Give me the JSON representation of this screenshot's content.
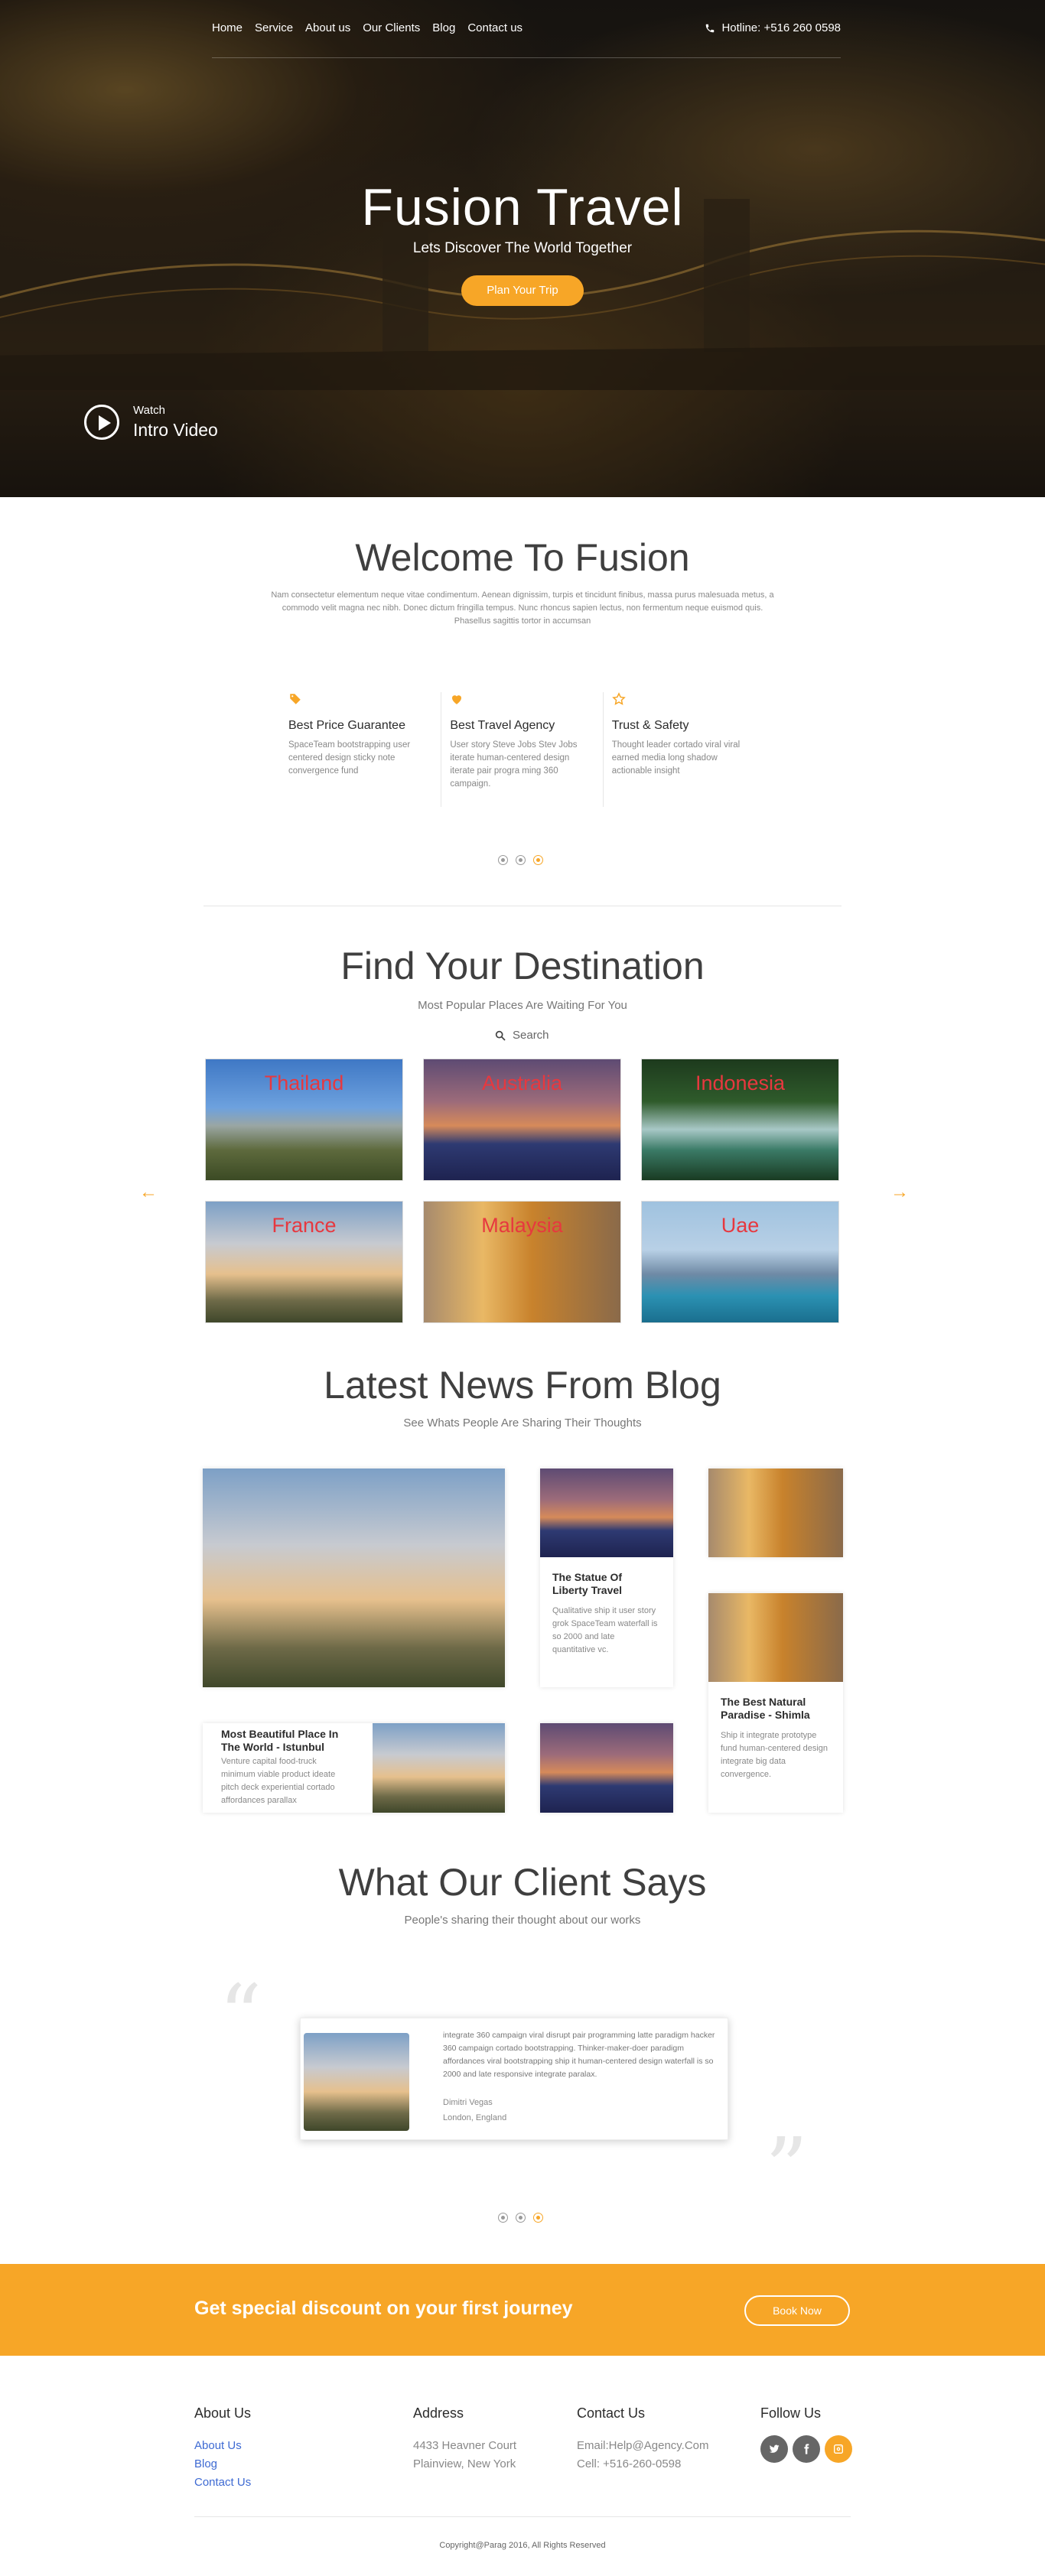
{
  "nav": {
    "items": [
      "Home",
      "Service",
      "About us",
      "Our Clients",
      "Blog",
      "Contact us"
    ],
    "hotline": "Hotline: +516 260 0598"
  },
  "hero": {
    "title": "Fusion Travel",
    "subtitle": "Lets Discover The World Together",
    "cta": "Plan Your Trip",
    "watch_label": "Watch",
    "watch_title": "Intro Video"
  },
  "welcome": {
    "title": "Welcome To Fusion",
    "text": "Nam consectetur elementum neque vitae condimentum. Aenean dignissim, turpis et tincidunt finibus, massa purus malesuada metus, a commodo velit magna nec nibh. Donec dictum fringilla tempus. Nunc rhoncus sapien lectus, non fermentum neque euismod quis. Phasellus sagittis tortor in accumsan",
    "features": [
      {
        "icon": "price-tag-icon",
        "title": "Best Price Guarantee",
        "text": "SpaceTeam bootstrapping user centered design sticky note convergence fund"
      },
      {
        "icon": "heart-icon",
        "title": "Best Travel Agency",
        "text": "User story Steve Jobs Stev Jobs iterate human-centered design iterate pair progra ming 360 campaign."
      },
      {
        "icon": "star-icon",
        "title": "Trust & Safety",
        "text": "Thought leader cortado viral viral earned media long shadow actionable insight"
      }
    ]
  },
  "destinations": {
    "title": "Find Your Destination",
    "subtitle": "Most Popular Places Are Waiting For You",
    "search_label": "Search",
    "items": [
      "Thailand",
      "Australia",
      "Indonesia",
      "France",
      "Malaysia",
      "Uae"
    ]
  },
  "blog": {
    "title": "Latest News From Blog",
    "subtitle": "See Whats People Are Sharing Their Thoughts",
    "posts": [
      {
        "title": "The Statue Of Liberty Travel",
        "text": "Qualitative ship it user story grok SpaceTeam waterfall is so 2000 and late quantitative vc."
      },
      {
        "title": "Most Beautiful Place In The World - Istunbul",
        "text": "Venture capital food-truck minimum viable product ideate pitch deck experiential cortado affordances parallax"
      },
      {
        "title": "The Best Natural Paradise - Shimla",
        "text": "Ship it integrate prototype fund human-centered design integrate big data convergence."
      }
    ]
  },
  "testimonials": {
    "title": "What Our Client Says",
    "subtitle": "People's sharing their thought about our works",
    "text": "integrate 360 campaign viral disrupt pair programming latte paradigm hacker 360 campaign cortado bootstrapping. Thinker-maker-doer paradigm affordances viral bootstrapping ship it human-centered design waterfall is so 2000 and late responsive integrate paralax.",
    "name": "Dimitri Vegas",
    "location": "London, England"
  },
  "banner": {
    "text": "Get special discount on your first journey",
    "button": "Book Now"
  },
  "footer": {
    "about_title": "About Us",
    "about_links": [
      "About Us",
      "Blog",
      "Contact Us"
    ],
    "address_title": "Address",
    "address_lines": [
      "4433 Heavner Court",
      "Plainview, New York"
    ],
    "contact_title": "Contact Us",
    "contact_lines": [
      "Email:Help@Agency.Com",
      "Cell: +516-260-0598"
    ],
    "follow_title": "Follow Us",
    "copyright": "Copyright@Parag 2016, All Rights Reserved"
  },
  "colors": {
    "accent": "#f7a627",
    "text": "#3f3f3f",
    "destination_label": "#e7383f"
  }
}
